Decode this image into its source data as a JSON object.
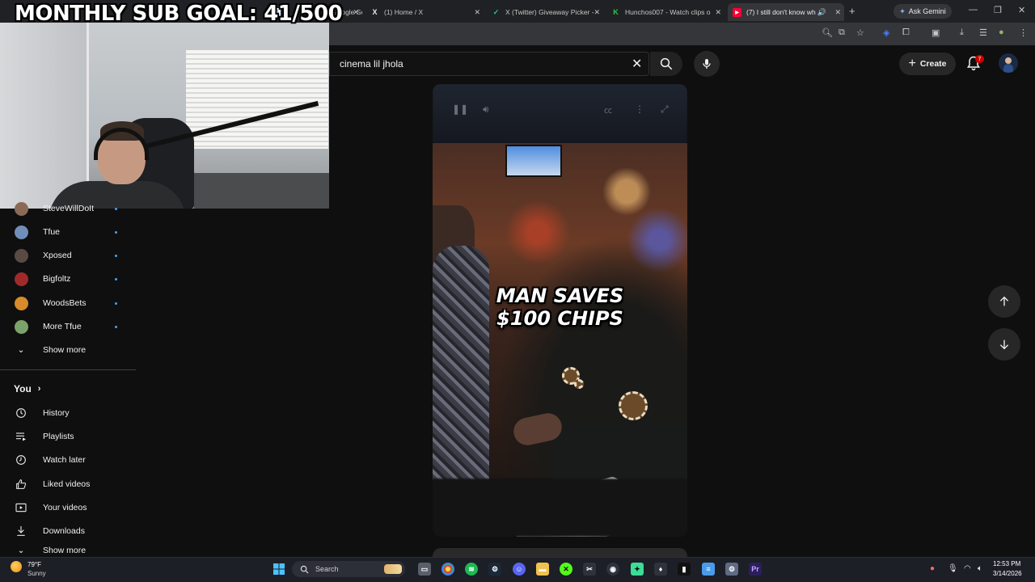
{
  "browser": {
    "tabs": [
      {
        "title": "Google Se",
        "fav_color": "#4285f4"
      },
      {
        "title": "(1) Home / X",
        "fav_color": "#000000"
      },
      {
        "title": "X (Twitter) Giveaway Picker -",
        "fav_color": "#1da1f2"
      },
      {
        "title": "Hunchos007 - Watch clips o",
        "fav_color": "#2bc44a"
      },
      {
        "title": "(7) I still don't know wh",
        "fav_color": "#ff0033"
      }
    ],
    "ask_gemini": "Ask Gemini"
  },
  "overlay": {
    "sub_goal": "MONTHLY SUB GOAL: 41/500"
  },
  "header": {
    "search_value": "cinema lil jhola",
    "create_label": "Create",
    "notification_count": "7"
  },
  "sidebar": {
    "subscriptions": [
      {
        "label": "SteveWillDoIt",
        "color": "#8a6a55"
      },
      {
        "label": "Tfue",
        "color": "#6f8fb8"
      },
      {
        "label": "Xposed",
        "color": "#5a4a44"
      },
      {
        "label": "Bigfoltz",
        "color": "#a02a2a"
      },
      {
        "label": "WoodsBets",
        "color": "#d98a2a"
      },
      {
        "label": "More Tfue",
        "color": "#7aa26a"
      }
    ],
    "show_more_label": "Show more",
    "you_heading": "You",
    "you_items": [
      {
        "label": "History",
        "icon": "history-icon"
      },
      {
        "label": "Playlists",
        "icon": "playlists-icon"
      },
      {
        "label": "Watch later",
        "icon": "watch-later-icon"
      },
      {
        "label": "Liked videos",
        "icon": "liked-videos-icon"
      },
      {
        "label": "Your videos",
        "icon": "your-videos-icon"
      },
      {
        "label": "Downloads",
        "icon": "downloads-icon"
      },
      {
        "label": "Show more",
        "icon": "chevron-down-icon"
      }
    ]
  },
  "short": {
    "caption_line1": "MAN SAVES",
    "caption_line2": "$100 CHIPS"
  },
  "taskbar": {
    "weather_temp": "79°F",
    "weather_desc": "Sunny",
    "search_label": "Search",
    "time": "12:53 PM",
    "date": "3/14/2026"
  },
  "colors": {
    "youtube_bg": "#0f0f0f",
    "accent_blue": "#3ea6ff",
    "notification_red": "#cc0000"
  }
}
